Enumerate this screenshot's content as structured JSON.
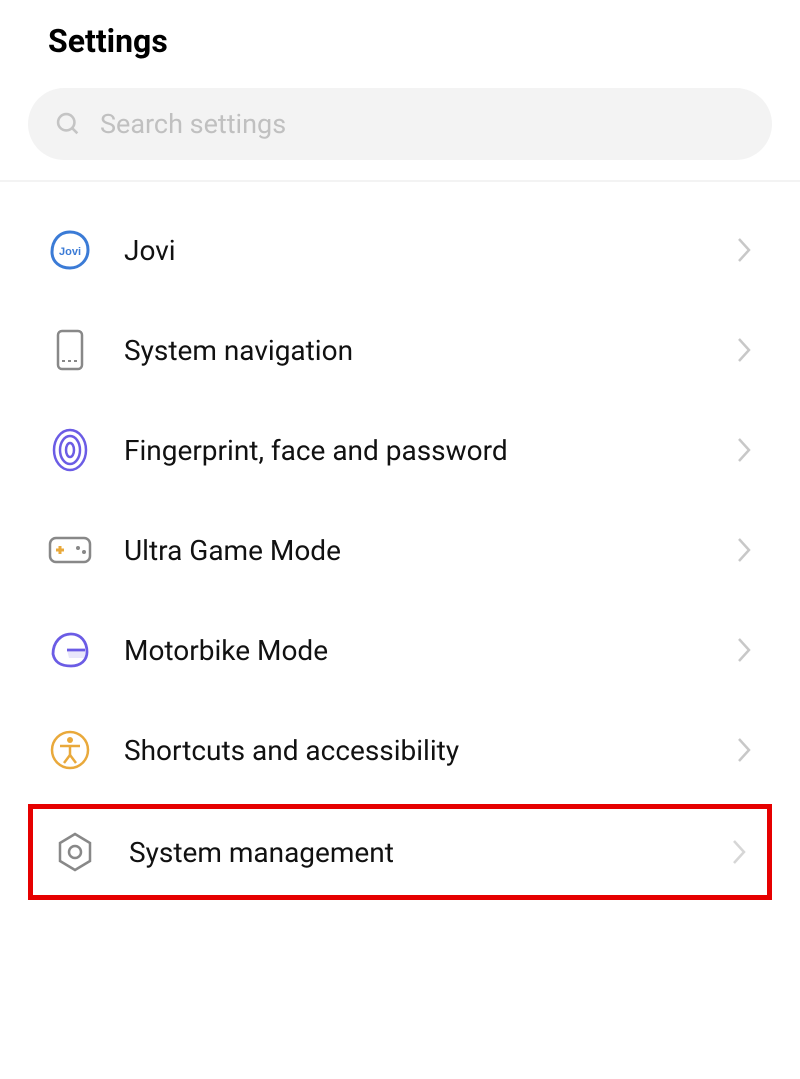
{
  "page_title": "Settings",
  "search": {
    "placeholder": "Search settings"
  },
  "items": [
    {
      "label": "Jovi"
    },
    {
      "label": "System navigation"
    },
    {
      "label": "Fingerprint, face and password"
    },
    {
      "label": "Ultra Game Mode"
    },
    {
      "label": "Motorbike Mode"
    },
    {
      "label": "Shortcuts and accessibility"
    },
    {
      "label": "System management"
    }
  ]
}
